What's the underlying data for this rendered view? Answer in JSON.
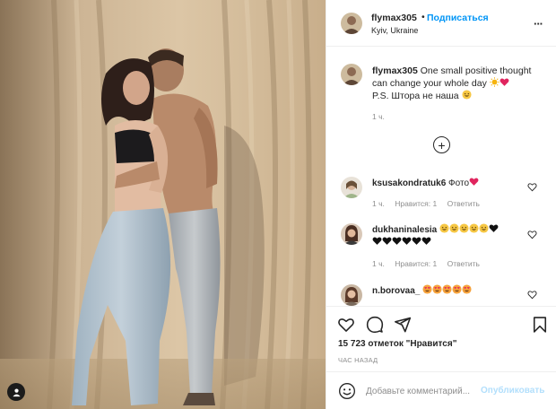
{
  "post": {
    "username": "flymax305",
    "follow_label": "Подписаться",
    "location": "Kyiv, Ukraine",
    "more_icon": "more-options-icon",
    "caption_text": "One small positive thought can change your whole day",
    "caption_line2": "P.S. Штора не наша",
    "caption_time": "1 ч."
  },
  "comments": [
    {
      "username": "ksusakondratuk6",
      "text": "Фото",
      "time": "1 ч.",
      "likes": "Нравится: 1",
      "reply": "Ответить"
    },
    {
      "username": "dukhaninalesia",
      "text": "",
      "time": "1 ч.",
      "likes": "Нравится: 1",
      "reply": "Ответить"
    },
    {
      "username": "n.borovaa_",
      "text": ""
    }
  ],
  "actions": {
    "likes_count": "15 723 отметок \"Нравится\"",
    "post_time": "ЧАС НАЗАД"
  },
  "add_comment": {
    "placeholder": "Добавьте комментарий...",
    "publish_label": "Опубликовать"
  },
  "colors": {
    "accent": "#0095f6",
    "publish_disabled": "#b2dffc",
    "muted": "#8e8e8e",
    "text": "#262626",
    "heart": "#e0245e"
  }
}
